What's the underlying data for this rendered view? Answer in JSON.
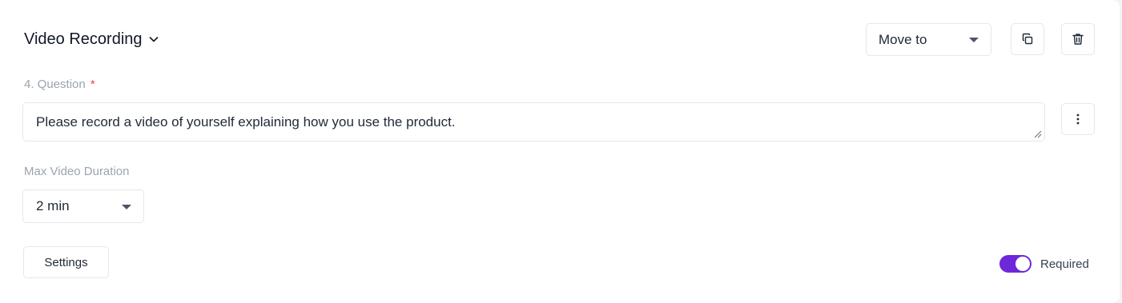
{
  "header": {
    "question_type": "Video Recording",
    "move_to": {
      "label": "Move to"
    },
    "icons": {
      "type_dropdown": "chevron-down-icon",
      "copy": "copy-icon",
      "delete": "trash-icon",
      "more": "more-vertical-icon"
    }
  },
  "question": {
    "label": "4. Question",
    "required_marker": "*",
    "value": "Please record a video of yourself explaining how you use the product."
  },
  "duration": {
    "label": "Max Video Duration",
    "selected": "2 min"
  },
  "footer": {
    "settings_label": "Settings",
    "required_label": "Required",
    "required_on": true,
    "toggle_color": "#6d28d9"
  }
}
